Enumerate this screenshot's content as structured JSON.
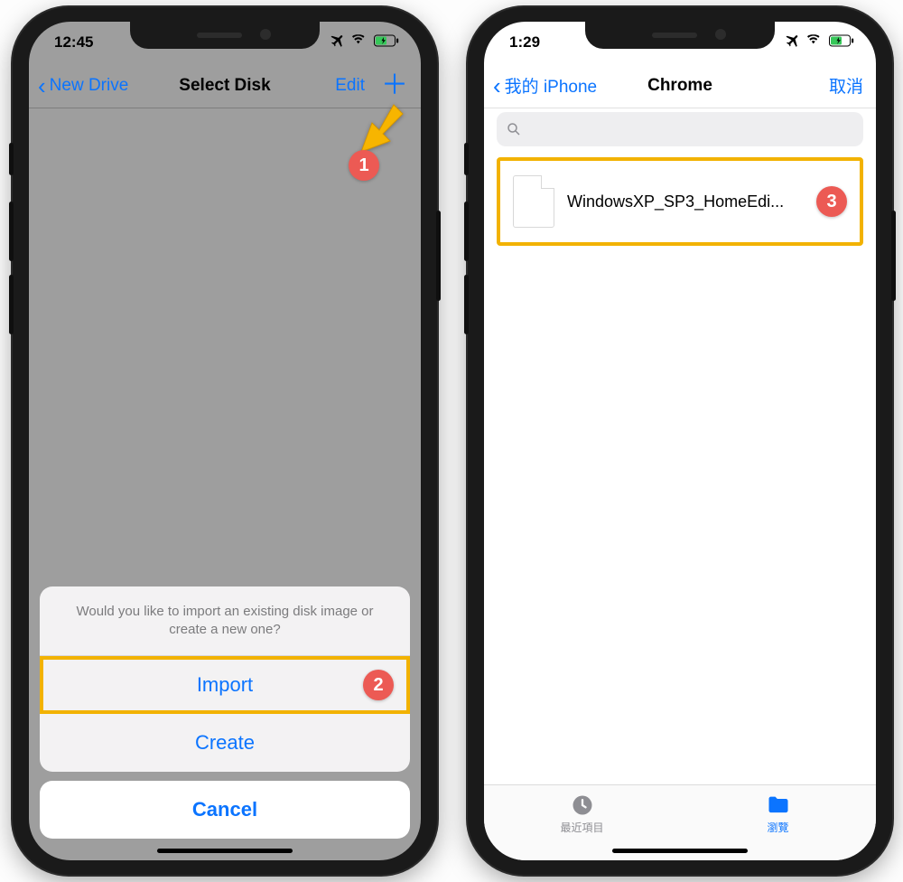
{
  "left_phone": {
    "status_time": "12:45",
    "nav_back_label": "New Drive",
    "nav_title": "Select Disk",
    "nav_edit_label": "Edit",
    "sheet_message": "Would you like to import an existing disk image or create a new one?",
    "sheet_import": "Import",
    "sheet_create": "Create",
    "sheet_cancel": "Cancel"
  },
  "right_phone": {
    "status_time": "1:29",
    "nav_back_label": "我的 iPhone",
    "nav_title": "Chrome",
    "nav_cancel_label": "取消",
    "file_name": "WindowsXP_SP3_HomeEdi...",
    "tab_recent": "最近項目",
    "tab_browse": "瀏覽"
  },
  "annotations": {
    "badge1": "1",
    "badge2": "2",
    "badge3": "3"
  },
  "colors": {
    "ios_blue": "#0b74ff",
    "highlight_yellow": "#f2b200",
    "badge_red": "#ec5a54"
  }
}
